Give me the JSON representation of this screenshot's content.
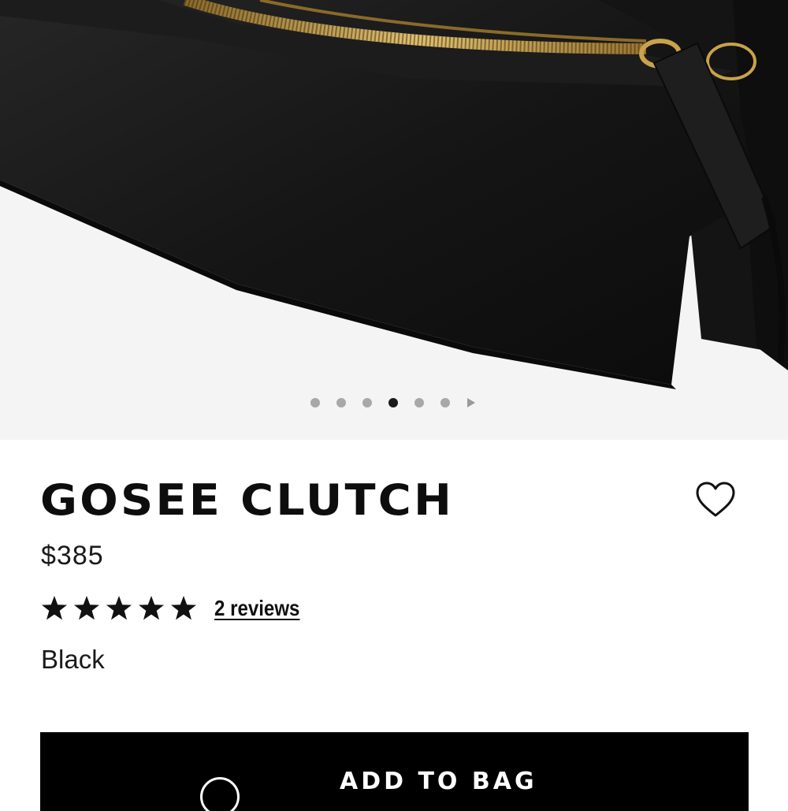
{
  "product": {
    "name": "GOSEE CLUTCH",
    "price": "$385",
    "rating_stars": 5,
    "reviews_label": "2 reviews",
    "color": "Black"
  },
  "gallery": {
    "image_count": 6,
    "active_index": 3
  },
  "actions": {
    "add_to_bag_label": "ADD TO BAG"
  },
  "icons": {
    "wishlist": "heart-outline-icon",
    "star": "star-filled-icon",
    "next": "play-arrow-icon"
  },
  "colors": {
    "button_bg": "#000000",
    "active_dot": "#1a1a1a",
    "inactive_dot": "#a8a8a8"
  }
}
